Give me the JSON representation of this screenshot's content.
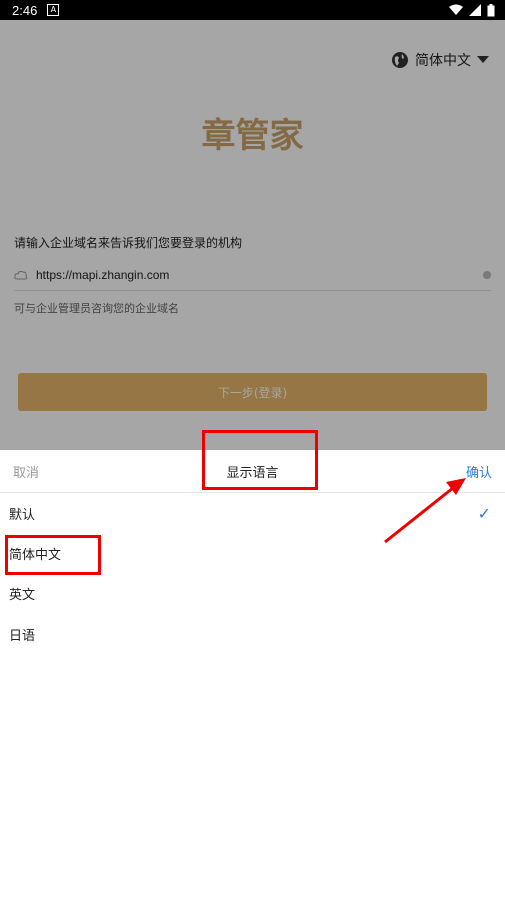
{
  "status_bar": {
    "time": "2:46",
    "notif_icon": "A"
  },
  "login_page": {
    "language_switch": "简体中文",
    "logo": "章管家",
    "domain_prompt": "请输入企业域名来告诉我们您要登录的机构",
    "domain_value": "https://mapi.zhangin.com",
    "hint": "可与企业管理员咨询您的企业域名",
    "next_button": "下一步(登录)"
  },
  "sheet": {
    "cancel": "取消",
    "title": "显示语言",
    "confirm": "确认",
    "options": [
      "默认",
      "简体中文",
      "英文",
      "日语"
    ],
    "selected_index": 0
  },
  "colors": {
    "accent": "#2f7ed8",
    "brand_gold": "#c9a46a",
    "annotation": "#e00000"
  }
}
